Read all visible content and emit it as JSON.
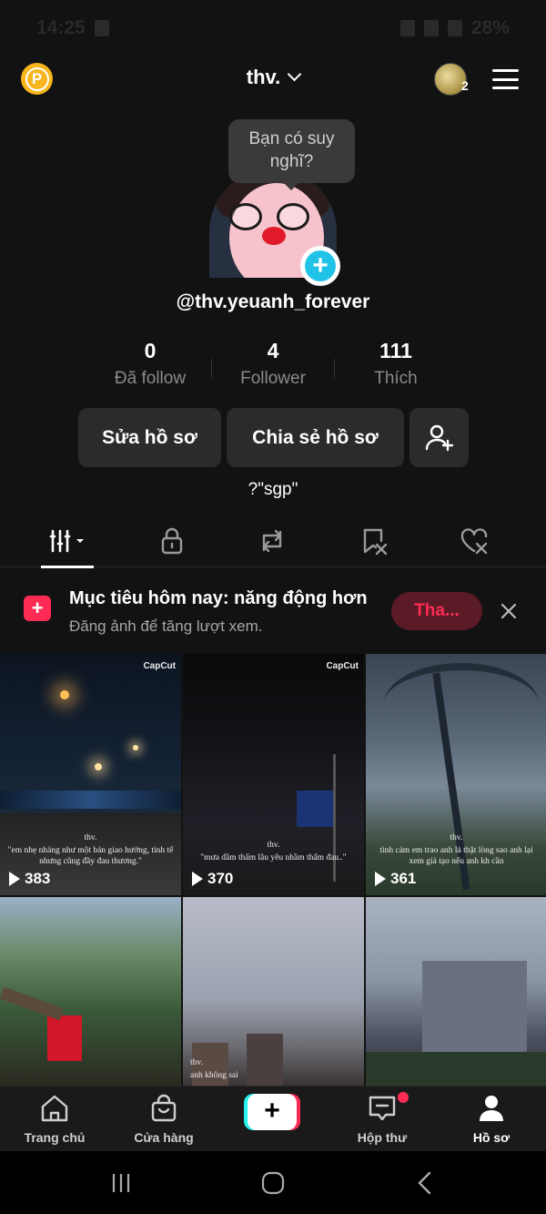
{
  "status_bar": {
    "time": "14:25",
    "battery": "28%"
  },
  "header": {
    "coin_letter": "P",
    "title": "thv.",
    "account_count": "2"
  },
  "tooltip": {
    "text": "Bạn có suy nghĩ?"
  },
  "profile": {
    "handle": "@thv.yeuanh_forever",
    "bio": "?\"sgp\""
  },
  "stats": [
    {
      "value": "0",
      "label": "Đã follow"
    },
    {
      "value": "4",
      "label": "Follower"
    },
    {
      "value": "111",
      "label": "Thích"
    }
  ],
  "buttons": {
    "edit": "Sửa hồ sơ",
    "share": "Chia sẻ hồ sơ"
  },
  "tabs": [
    {
      "icon": "grid-icon"
    },
    {
      "icon": "lock-icon"
    },
    {
      "icon": "repost-icon"
    },
    {
      "icon": "favorites-icon"
    },
    {
      "icon": "liked-icon"
    }
  ],
  "goal": {
    "title": "Mục tiêu hôm nay: năng động hơn",
    "subtitle": "Đăng ảnh để tăng lượt xem.",
    "button": "Tha..."
  },
  "videos": [
    {
      "views": "383",
      "watermark": "CapCut",
      "caption_name": "thv.",
      "caption": "\"em nhẹ nhàng như một bản giao hưởng, tinh tế nhưng cũng đầy đau thương.\""
    },
    {
      "views": "370",
      "watermark": "CapCut",
      "caption_name": "thv.",
      "caption": "\"mưa dầm thấm lâu yêu nhầm thấm đau..\""
    },
    {
      "views": "361",
      "watermark": "",
      "caption_name": "thv.",
      "caption": "tình cảm em trao anh là thật lòng sao anh lại xem giả tạo nếu anh kh cần"
    },
    {
      "views": "",
      "watermark": "",
      "caption_name": "",
      "caption": ""
    },
    {
      "views": "",
      "watermark": "",
      "caption_name": "thv.",
      "caption": "anh không sai"
    },
    {
      "views": "",
      "watermark": "",
      "caption_name": "",
      "caption": ""
    }
  ],
  "bottom_nav": [
    {
      "label": "Trang chủ",
      "icon": "home-icon"
    },
    {
      "label": "Cửa hàng",
      "icon": "shop-icon"
    },
    {
      "label": "Hộp thư",
      "icon": "inbox-icon"
    },
    {
      "label": "Hồ sơ",
      "icon": "profile-icon"
    }
  ],
  "colors": {
    "accent": "#fe2c55",
    "cyan": "#25f4ee",
    "background": "#121212"
  }
}
